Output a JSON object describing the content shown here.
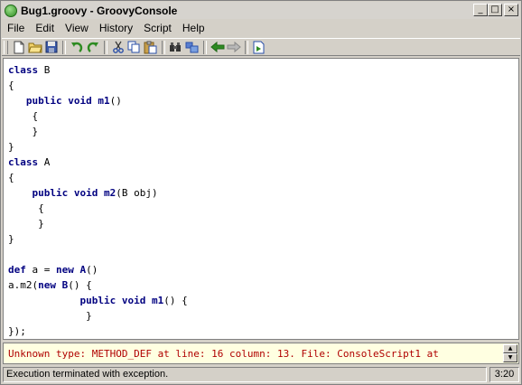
{
  "window": {
    "title": "Bug1.groovy - GroovyConsole",
    "minimize": "_",
    "maximize": "□",
    "close": "×"
  },
  "menu": [
    "File",
    "Edit",
    "View",
    "History",
    "Script",
    "Help"
  ],
  "toolbar": {
    "icons": [
      "new-file-icon",
      "open-folder-icon",
      "save-icon",
      "undo-icon",
      "redo-icon",
      "cut-icon",
      "copy-icon",
      "paste-icon",
      "find-icon",
      "replace-icon",
      "history-previous-icon",
      "history-next-icon",
      "run-script-icon"
    ]
  },
  "editor": {
    "lines": [
      [
        {
          "k": 1,
          "t": "class"
        },
        {
          "k": 0,
          "t": " B"
        }
      ],
      [
        {
          "k": 0,
          "t": "{"
        }
      ],
      [
        {
          "k": 0,
          "t": "   "
        },
        {
          "k": 1,
          "t": "public"
        },
        {
          "k": 0,
          "t": " "
        },
        {
          "k": 1,
          "t": "void"
        },
        {
          "k": 0,
          "t": " "
        },
        {
          "k": 1,
          "t": "m1"
        },
        {
          "k": 0,
          "t": "()"
        }
      ],
      [
        {
          "k": 0,
          "t": "    {"
        }
      ],
      [
        {
          "k": 0,
          "t": "    }"
        }
      ],
      [
        {
          "k": 0,
          "t": "}"
        }
      ],
      [
        {
          "k": 1,
          "t": "class"
        },
        {
          "k": 0,
          "t": " A"
        }
      ],
      [
        {
          "k": 0,
          "t": "{"
        }
      ],
      [
        {
          "k": 0,
          "t": "    "
        },
        {
          "k": 1,
          "t": "public"
        },
        {
          "k": 0,
          "t": " "
        },
        {
          "k": 1,
          "t": "void"
        },
        {
          "k": 0,
          "t": " "
        },
        {
          "k": 1,
          "t": "m2"
        },
        {
          "k": 0,
          "t": "(B obj)"
        }
      ],
      [
        {
          "k": 0,
          "t": "     {"
        }
      ],
      [
        {
          "k": 0,
          "t": "     }"
        }
      ],
      [
        {
          "k": 0,
          "t": "}"
        }
      ],
      [
        {
          "k": 0,
          "t": ""
        }
      ],
      [
        {
          "k": 1,
          "t": "def"
        },
        {
          "k": 0,
          "t": " a = "
        },
        {
          "k": 1,
          "t": "new"
        },
        {
          "k": 0,
          "t": " "
        },
        {
          "k": 1,
          "t": "A"
        },
        {
          "k": 0,
          "t": "()"
        }
      ],
      [
        {
          "k": 0,
          "t": "a.m2("
        },
        {
          "k": 1,
          "t": "new"
        },
        {
          "k": 0,
          "t": " "
        },
        {
          "k": 1,
          "t": "B"
        },
        {
          "k": 0,
          "t": "() {"
        }
      ],
      [
        {
          "k": 0,
          "t": "            "
        },
        {
          "k": 1,
          "t": "public"
        },
        {
          "k": 0,
          "t": " "
        },
        {
          "k": 1,
          "t": "void"
        },
        {
          "k": 0,
          "t": " "
        },
        {
          "k": 1,
          "t": "m1"
        },
        {
          "k": 0,
          "t": "() {"
        }
      ],
      [
        {
          "k": 0,
          "t": "             }"
        }
      ],
      [
        {
          "k": 0,
          "t": "});"
        }
      ]
    ]
  },
  "output": {
    "text": "Unknown type: METHOD_DEF at line: 16 column: 13. File: ConsoleScript1 at"
  },
  "status": {
    "message": "Execution terminated with exception.",
    "position": "3:20"
  }
}
